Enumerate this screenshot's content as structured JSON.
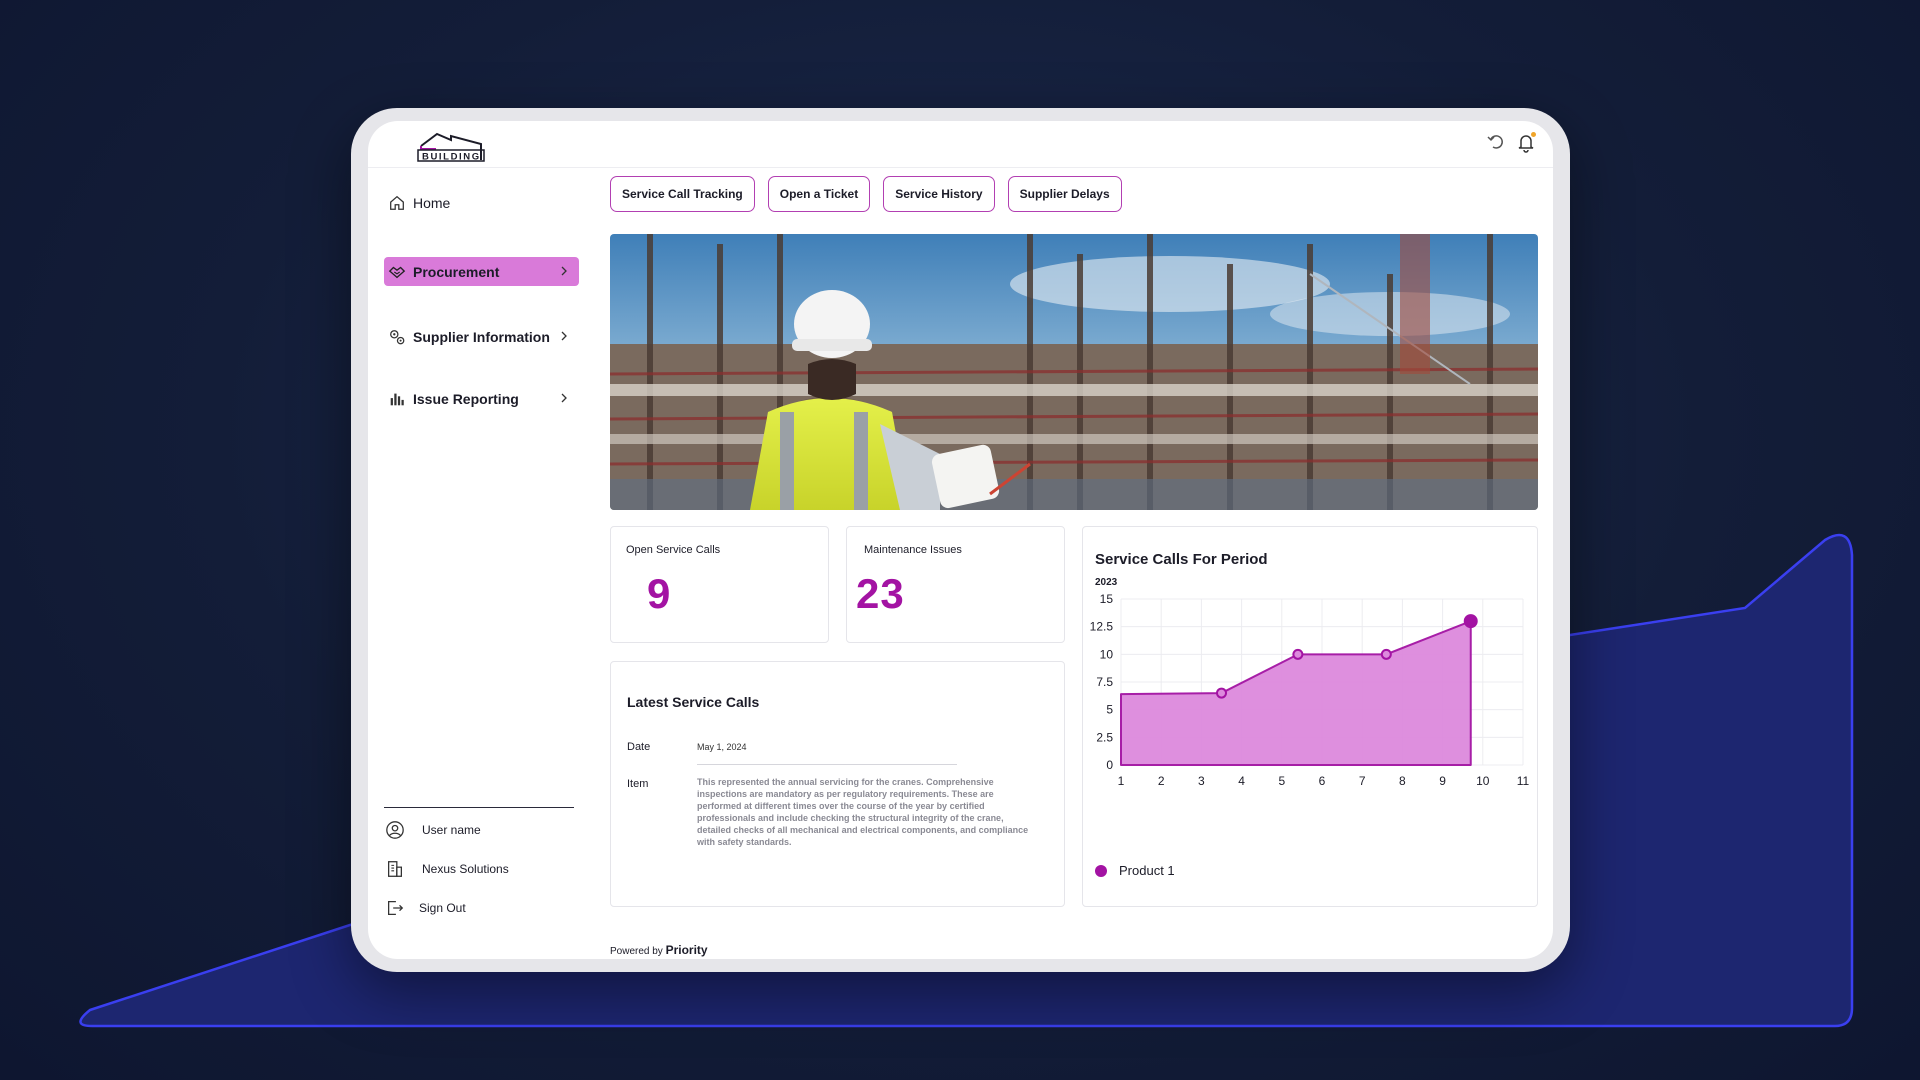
{
  "colors": {
    "accent": "#a313a3",
    "active_nav": "#d97ad9",
    "tab_border": "#b23fb2",
    "background": "#131d38"
  },
  "header": {
    "logo_text": "BUILDING",
    "icons": [
      "undo-icon",
      "bell-icon"
    ]
  },
  "sidebar": {
    "items": [
      {
        "label": "Home",
        "icon": "home-icon",
        "active": false
      },
      {
        "label": "Procurement",
        "icon": "handshake-icon",
        "active": true
      },
      {
        "label": "Supplier Information",
        "icon": "gears-icon",
        "active": false
      },
      {
        "label": "Issue Reporting",
        "icon": "bar-chart-icon",
        "active": false
      }
    ],
    "footer": [
      {
        "label": "User name",
        "icon": "user-circle-icon"
      },
      {
        "label": "Nexus Solutions",
        "icon": "building-icon"
      },
      {
        "label": "Sign Out",
        "icon": "sign-out-icon"
      }
    ]
  },
  "tabs": [
    "Service Call Tracking",
    "Open a Ticket",
    "Service History",
    "Supplier Delays"
  ],
  "kpis": [
    {
      "label": "Open Service Calls",
      "value": "9"
    },
    {
      "label": "Maintenance Issues",
      "value": "23"
    }
  ],
  "latest_service_calls": {
    "title": "Latest Service Calls",
    "date_label": "Date",
    "date_value": "May 1, 2024",
    "item_label": "Item",
    "item_value": "This represented the annual servicing for the cranes. Comprehensive inspections are mandatory as per regulatory requirements. These are performed at different times over the course of the year by certified professionals and include checking the structural integrity of the crane, detailed checks of all mechanical and electrical components, and compliance with safety standards."
  },
  "chart_data": {
    "type": "area",
    "title": "Service Calls For Period",
    "subtitle": "2023",
    "x_ticks": [
      1,
      2,
      3,
      4,
      5,
      6,
      7,
      8,
      9,
      10,
      11
    ],
    "y_ticks": [
      0,
      2.5,
      5,
      7.5,
      10,
      12.5,
      15
    ],
    "xlim": [
      1,
      11
    ],
    "ylim": [
      0,
      15
    ],
    "grid": true,
    "legend_position": "bottom-left",
    "series": [
      {
        "name": "Product 1",
        "color": "#a313a3",
        "fill": "#dd8add",
        "x": [
          1,
          3.5,
          5.4,
          7.6,
          9.7
        ],
        "y": [
          6.4,
          6.5,
          10,
          10,
          13
        ]
      }
    ]
  },
  "footer": {
    "powered_prefix": "Powered by",
    "powered_brand": "Priority"
  }
}
